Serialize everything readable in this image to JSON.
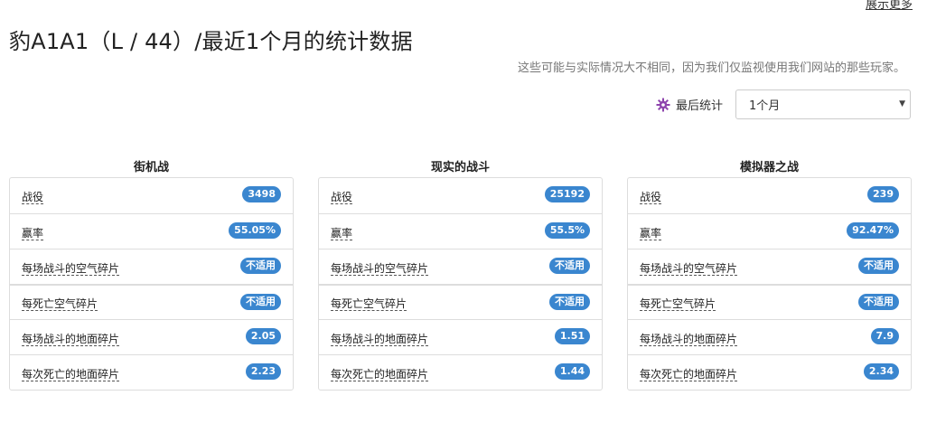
{
  "header": {
    "show_more": "展示更多",
    "title": "豹A1A1（L / 44）/最近1个月的统计数据",
    "disclaimer": "这些可能与实际情况大不相同，因为我们仅监视使用我们网站的那些玩家。",
    "last_stats_label": "最后统计",
    "period_value": "1个月"
  },
  "columns": [
    {
      "title": "街机战",
      "rows": [
        {
          "label": "战役",
          "value": "3498"
        },
        {
          "label": "赢率",
          "value": "55.05%"
        },
        {
          "label": "每场战斗的空气碎片",
          "value": "不适用"
        },
        {
          "label": "每死亡空气碎片",
          "value": "不适用"
        },
        {
          "label": "每场战斗的地面碎片",
          "value": "2.05"
        },
        {
          "label": "每次死亡的地面碎片",
          "value": "2.23"
        }
      ]
    },
    {
      "title": "现实的战斗",
      "rows": [
        {
          "label": "战役",
          "value": "25192"
        },
        {
          "label": "赢率",
          "value": "55.5%"
        },
        {
          "label": "每场战斗的空气碎片",
          "value": "不适用"
        },
        {
          "label": "每死亡空气碎片",
          "value": "不适用"
        },
        {
          "label": "每场战斗的地面碎片",
          "value": "1.51"
        },
        {
          "label": "每次死亡的地面碎片",
          "value": "1.44"
        }
      ]
    },
    {
      "title": "模拟器之战",
      "rows": [
        {
          "label": "战役",
          "value": "239"
        },
        {
          "label": "赢率",
          "value": "92.47%"
        },
        {
          "label": "每场战斗的空气碎片",
          "value": "不适用"
        },
        {
          "label": "每死亡空气碎片",
          "value": "不适用"
        },
        {
          "label": "每场战斗的地面碎片",
          "value": "7.9"
        },
        {
          "label": "每次死亡的地面碎片",
          "value": "2.34"
        }
      ]
    }
  ],
  "icons": {
    "last_stats": "gear-icon"
  },
  "colors": {
    "badge": "#3a86cf",
    "gear": "#8e44ad"
  }
}
